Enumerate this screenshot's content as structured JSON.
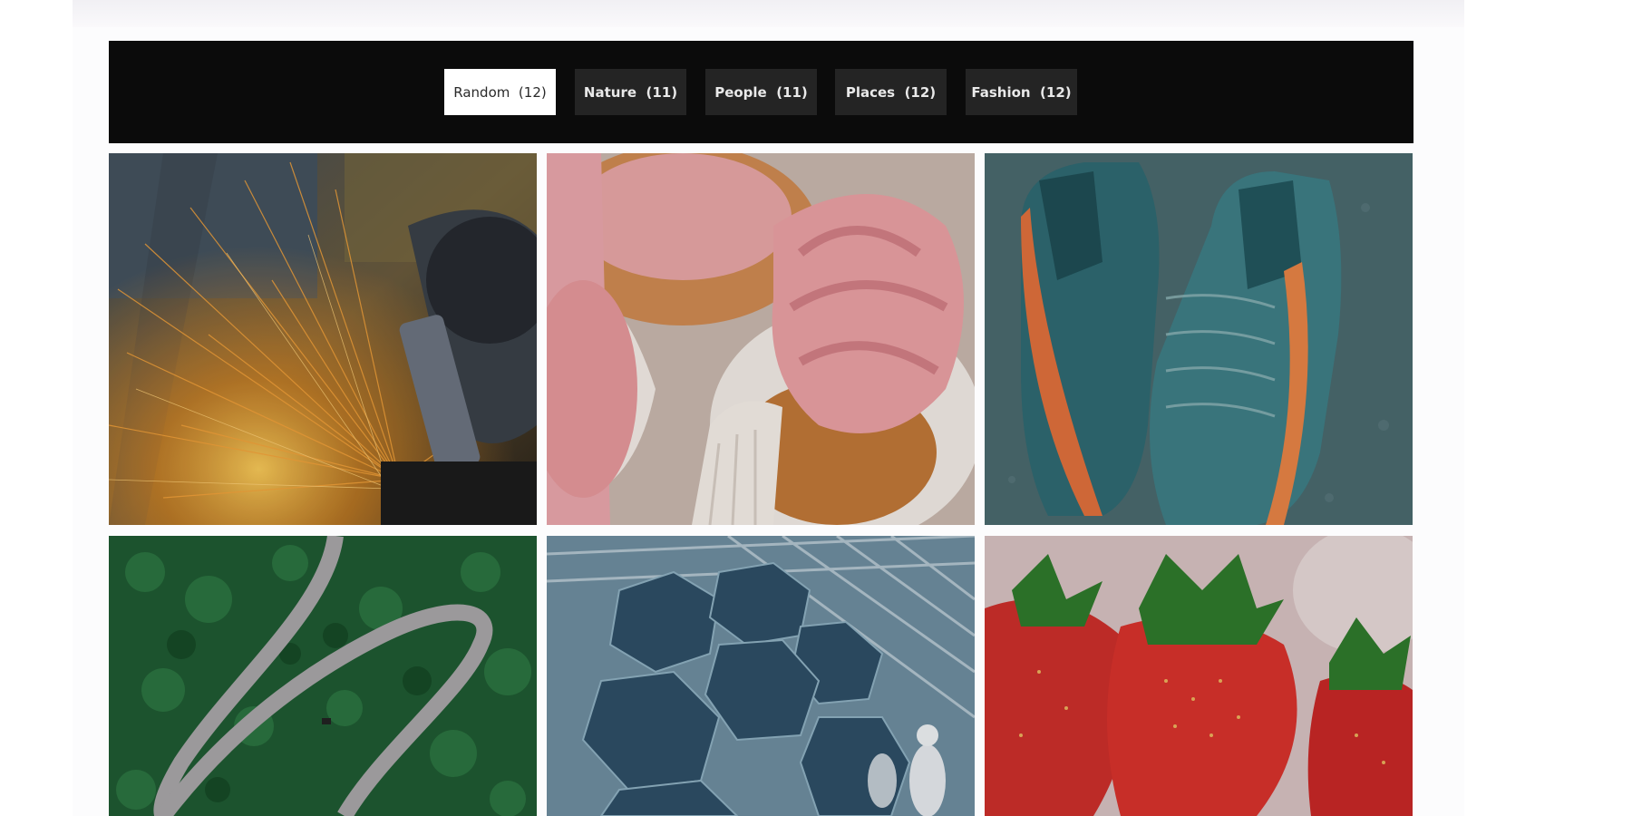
{
  "filters": [
    {
      "label": "Random",
      "count": "(12)",
      "active": true
    },
    {
      "label": "Nature",
      "count": "(11)",
      "active": false
    },
    {
      "label": "People",
      "count": "(11)",
      "active": false
    },
    {
      "label": "Places",
      "count": "(12)",
      "active": false
    },
    {
      "label": "Fashion",
      "count": "(12)",
      "active": false
    }
  ],
  "gallery": {
    "items": [
      {
        "subject": "angle grinder with sparks"
      },
      {
        "subject": "pink frosted cupcakes"
      },
      {
        "subject": "teal sneakers with orange stripe"
      },
      {
        "subject": "winding road through forest"
      },
      {
        "subject": "hexagonal telescope mirrors"
      },
      {
        "subject": "strawberries in bowl"
      }
    ]
  },
  "colors": {
    "filter_bar_bg": "#0b0b0b",
    "filter_btn_bg": "#242424",
    "filter_btn_active_bg": "#ffffff"
  }
}
